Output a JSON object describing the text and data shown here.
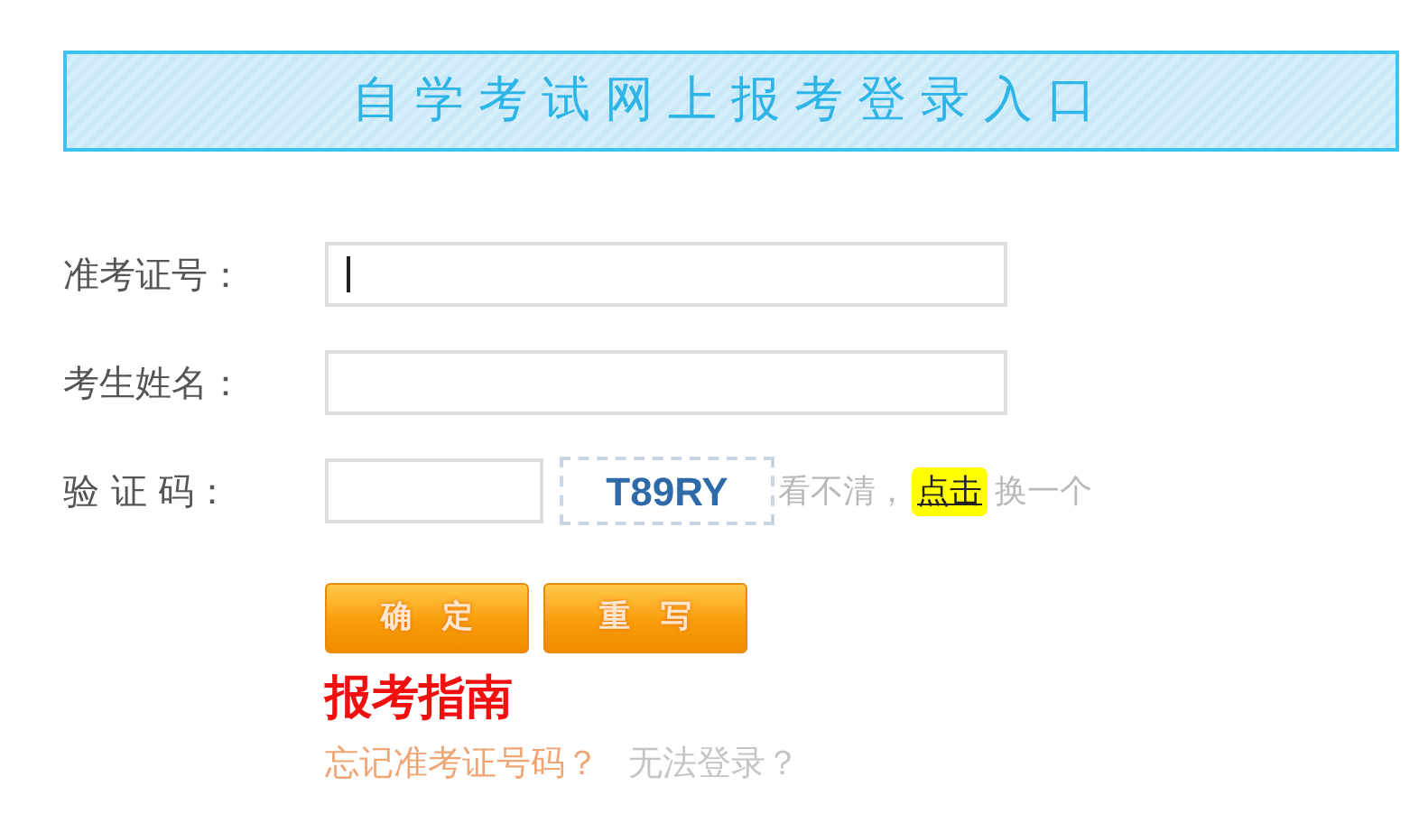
{
  "banner": {
    "title": "自学考试网上报考登录入口"
  },
  "fields": [
    {
      "label": "准考证号：",
      "kind": "text",
      "focused": true
    },
    {
      "label": "考生姓名：",
      "kind": "text",
      "focused": false
    },
    {
      "label": "验 证 码：",
      "kind": "captcha",
      "focused": false,
      "captcha": "T89RY",
      "hint_before": "看不清，",
      "hint_link": "点击",
      "hint_after": "换一个"
    }
  ],
  "buttons": [
    "确　定",
    "重　写"
  ],
  "guide": {
    "title": "报考指南",
    "links": [
      {
        "text": "忘记准考证号码？",
        "kind": "primary"
      },
      {
        "text": "无法登录？",
        "kind": "muted"
      }
    ]
  }
}
